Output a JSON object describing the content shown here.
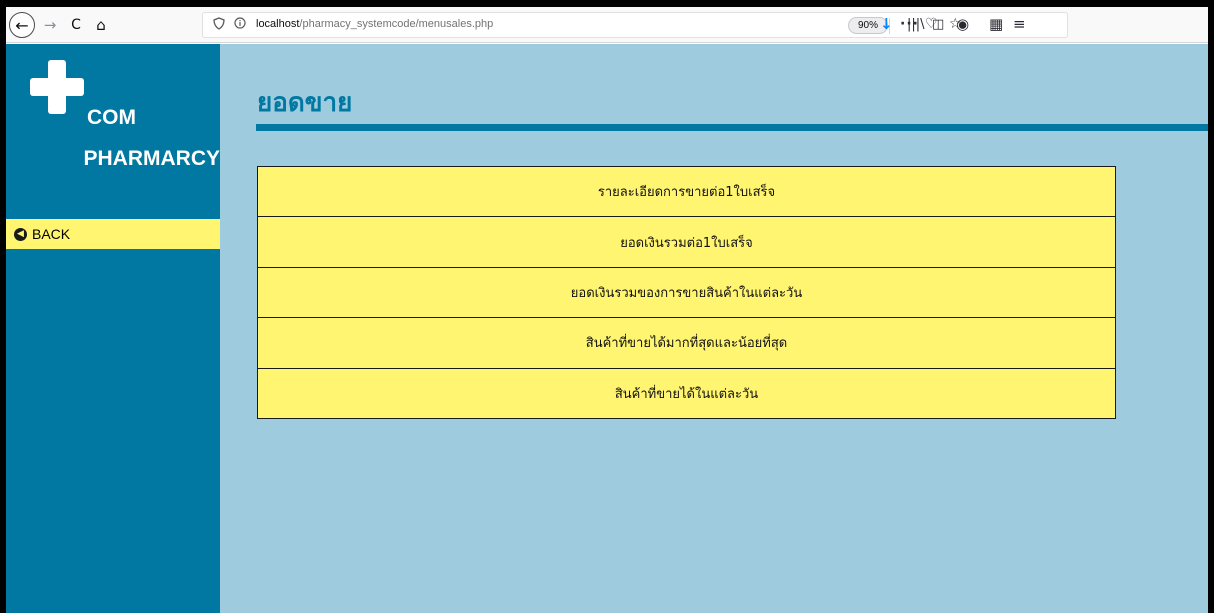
{
  "browser": {
    "back_icon": "←",
    "forward_icon": "→",
    "reload_icon": "C",
    "home_icon": "⌂",
    "url_host": "localhost",
    "url_path": "/pharmacy_systemcode/menusales.php",
    "zoom": "90%",
    "more_icon": "···",
    "pocket_icon": "♡",
    "star_icon": "☆",
    "download_icon": "↓",
    "library_icon": "|||\\",
    "sidebar_icon": "◫",
    "account_icon": "◉",
    "extension_icon": "▦",
    "menu_icon": "≡"
  },
  "sidebar": {
    "brand_line1": "COM",
    "brand_line2": "PHARMARCY",
    "back_label": "BACK",
    "back_icon": "◀"
  },
  "main": {
    "title": "ยอดขาย",
    "menu_items": [
      "รายละเอียดการขายต่อ1ใบเสร็จ",
      "ยอดเงินรวมต่อ1ใบเสร็จ",
      "ยอดเงินรวมของการขายสินค้าในแต่ละวัน",
      "สินค้าที่ขายได้มากที่สุดและน้อยที่สุด",
      "สินค้าที่ขายได้ในแต่ละวัน"
    ]
  },
  "colors": {
    "sidebar_bg": "#0078a1",
    "page_bg": "#9ecbdd",
    "menu_bg": "#fff570"
  }
}
